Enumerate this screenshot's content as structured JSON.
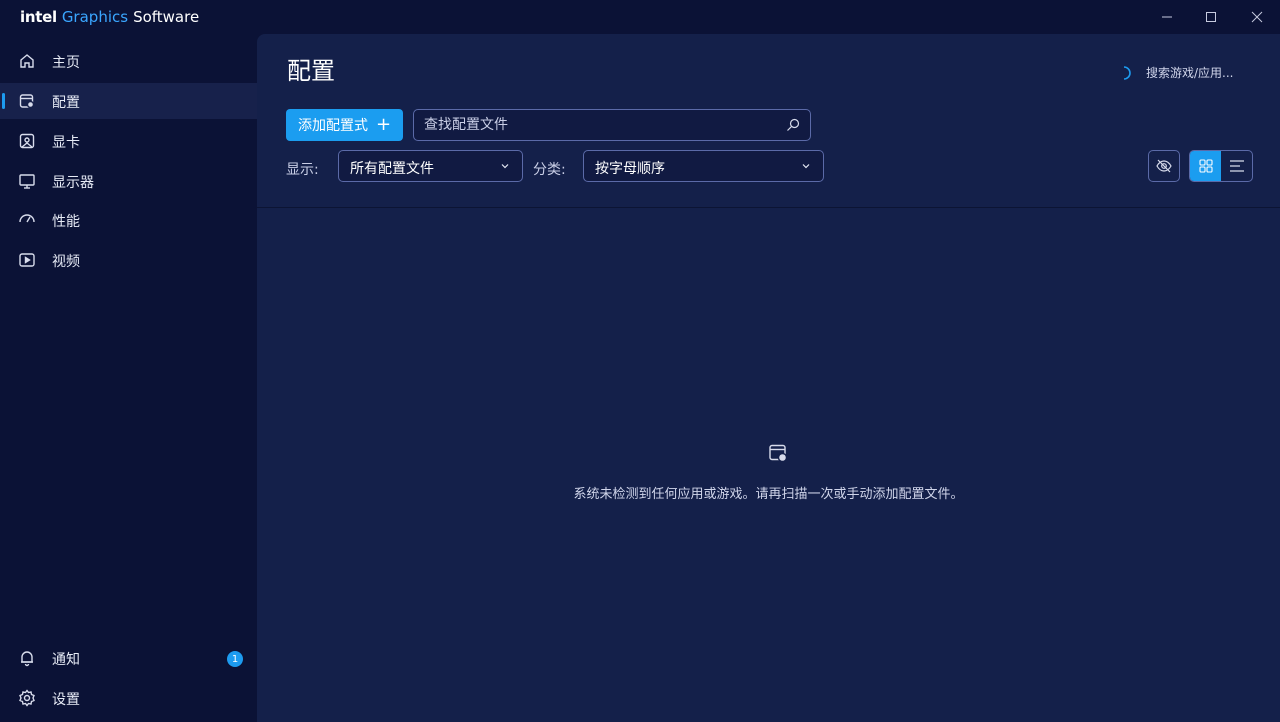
{
  "app": {
    "brand_intel": "intel",
    "brand_graphics": "Graphics",
    "brand_software": "Software"
  },
  "window_controls": [
    "minimize-icon",
    "maximize-icon",
    "close-icon"
  ],
  "sidebar": {
    "items": [
      {
        "label": "主页",
        "icon": "home-icon"
      },
      {
        "label": "配置",
        "icon": "profile-icon",
        "active": true
      },
      {
        "label": "显卡",
        "icon": "gpu-icon"
      },
      {
        "label": "显示器",
        "icon": "monitor-icon"
      },
      {
        "label": "性能",
        "icon": "gauge-icon"
      },
      {
        "label": "视频",
        "icon": "video-icon"
      }
    ],
    "bottom": [
      {
        "label": "通知",
        "icon": "bell-icon",
        "badge": "1"
      },
      {
        "label": "设置",
        "icon": "gear-icon"
      }
    ]
  },
  "main": {
    "title": "配置",
    "scan_status": "搜索游戏/应用...",
    "add_button": "添加配置式",
    "search": {
      "placeholder": "查找配置文件",
      "value": ""
    },
    "show_label": "显示:",
    "show_value": "所有配置文件",
    "sort_label": "分类:",
    "sort_value": "按字母顺序",
    "view_mode": "grid",
    "empty_message": "系统未检测到任何应用或游戏。请再扫描一次或手动添加配置文件。"
  },
  "colors": {
    "accent": "#1b9df0",
    "sidebar_bg": "#0b1236",
    "main_bg": "#14204a"
  }
}
